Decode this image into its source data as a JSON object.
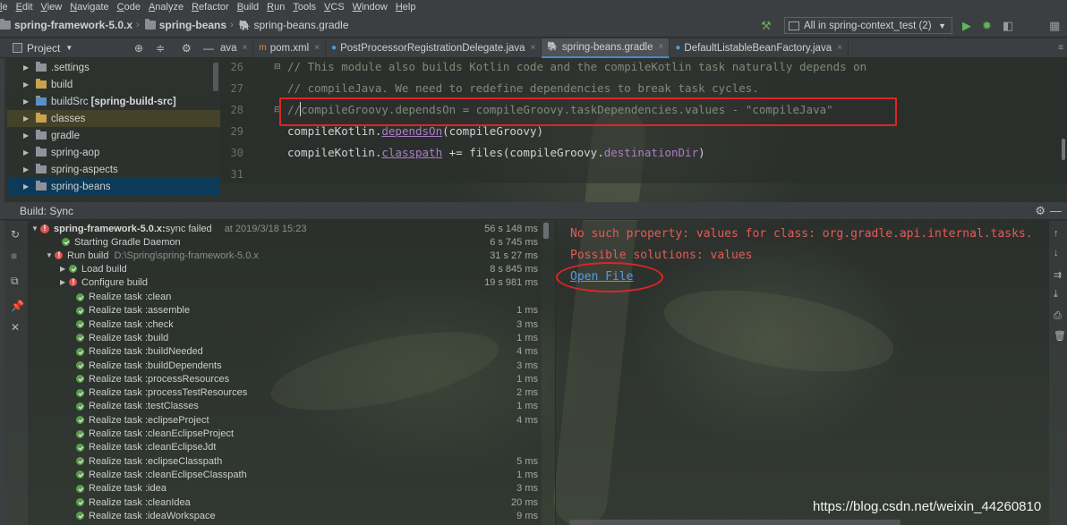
{
  "menu": [
    "le",
    "Edit",
    "View",
    "Navigate",
    "Code",
    "Analyze",
    "Refactor",
    "Build",
    "Run",
    "Tools",
    "VCS",
    "Window",
    "Help"
  ],
  "breadcrumbs": [
    "spring-framework-5.0.x",
    "spring-beans",
    "spring-beans.gradle"
  ],
  "run_config": "All in spring-context_test (2)",
  "project_panel": {
    "title": "Project",
    "items": [
      {
        "label": ".settings",
        "bold": ""
      },
      {
        "label": "build",
        "bold": ""
      },
      {
        "label": "buildSrc",
        "bold": "[spring-build-src]"
      },
      {
        "label": "classes",
        "bold": ""
      },
      {
        "label": "gradle",
        "bold": ""
      },
      {
        "label": "spring-aop",
        "bold": ""
      },
      {
        "label": "spring-aspects",
        "bold": ""
      },
      {
        "label": "spring-beans",
        "bold": ""
      }
    ]
  },
  "tabs": [
    {
      "label": "ava"
    },
    {
      "label": "pom.xml"
    },
    {
      "label": "PostProcessorRegistrationDelegate.java"
    },
    {
      "label": "spring-beans.gradle"
    },
    {
      "label": "DefaultListableBeanFactory.java"
    }
  ],
  "editor": {
    "lines": [
      {
        "num": "26",
        "text": "// This module also builds Kotlin code and the compileKotlin task naturally depends on"
      },
      {
        "num": "27",
        "text": "// compileJava. We need to redefine dependencies to break task cycles."
      },
      {
        "num": "28",
        "text": "compileGroovy.dependsOn = compileGroovy.taskDependencies.values - \"compileJava\""
      },
      {
        "num": "29",
        "text": "compileKotlin.dependsOn(compileGroovy)"
      },
      {
        "num": "30",
        "text": "compileKotlin.classpath += files(compileGroovy.destinationDir)"
      },
      {
        "num": "31",
        "text": ""
      }
    ],
    "line28": {
      "prefix": "//",
      "a": "compileGroovy",
      "b": ".",
      "c": "dependsOn",
      "d": " = ",
      "e": "compileGroovy",
      "f": ".",
      "g": "taskDependencies",
      "h": ".",
      "i": "values",
      "j": " - ",
      "k": "\"compileJava\""
    },
    "line29": {
      "a": "compileKotlin",
      "b": ".",
      "c": "dependsOn",
      "d": "(compileGroovy)"
    },
    "line30": {
      "a": "compileKotlin",
      "b": ".",
      "c": "classpath",
      "d": " += files(compileGroovy.",
      "e": "destinationDir",
      "f": ")"
    }
  },
  "build": {
    "title": "Build: Sync",
    "rows": [
      {
        "label": "spring-framework-5.0.x:",
        "extra": " sync failed",
        "muted": "at 2019/3/18 15:23",
        "time": "56 s 148 ms"
      },
      {
        "label": "Starting Gradle Daemon",
        "time": "6 s 745 ms"
      },
      {
        "label": "Run build",
        "path": "D:\\Spring\\spring-framework-5.0.x",
        "time": "31 s 27 ms"
      },
      {
        "label": "Load build",
        "time": "8 s 845 ms"
      },
      {
        "label": "Configure build",
        "time": "19 s 981 ms"
      },
      {
        "label": "Realize task :clean",
        "time": ""
      },
      {
        "label": "Realize task :assemble",
        "time": "1 ms"
      },
      {
        "label": "Realize task :check",
        "time": "3 ms"
      },
      {
        "label": "Realize task :build",
        "time": "1 ms"
      },
      {
        "label": "Realize task :buildNeeded",
        "time": "4 ms"
      },
      {
        "label": "Realize task :buildDependents",
        "time": "3 ms"
      },
      {
        "label": "Realize task :processResources",
        "time": "1 ms"
      },
      {
        "label": "Realize task :processTestResources",
        "time": "2 ms"
      },
      {
        "label": "Realize task :testClasses",
        "time": "1 ms"
      },
      {
        "label": "Realize task :eclipseProject",
        "time": "4 ms"
      },
      {
        "label": "Realize task :cleanEclipseProject",
        "time": ""
      },
      {
        "label": "Realize task :cleanEclipseJdt",
        "time": ""
      },
      {
        "label": "Realize task :eclipseClasspath",
        "time": "5 ms"
      },
      {
        "label": "Realize task :cleanEclipseClasspath",
        "time": "1 ms"
      },
      {
        "label": "Realize task :idea",
        "time": "3 ms"
      },
      {
        "label": "Realize task :cleanIdea",
        "time": "20 ms"
      },
      {
        "label": "Realize task :ideaWorkspace",
        "time": "9 ms"
      }
    ],
    "output": {
      "error": "No such property: values for class: org.gradle.api.internal.tasks.",
      "solutions": "Possible solutions: values",
      "link": "Open File"
    }
  },
  "watermark": "https://blog.csdn.net/weixin_44260810",
  "colors": {
    "error_red": "#e02424",
    "link_blue": "#5a9ae0",
    "selection": "#0d3a58"
  }
}
